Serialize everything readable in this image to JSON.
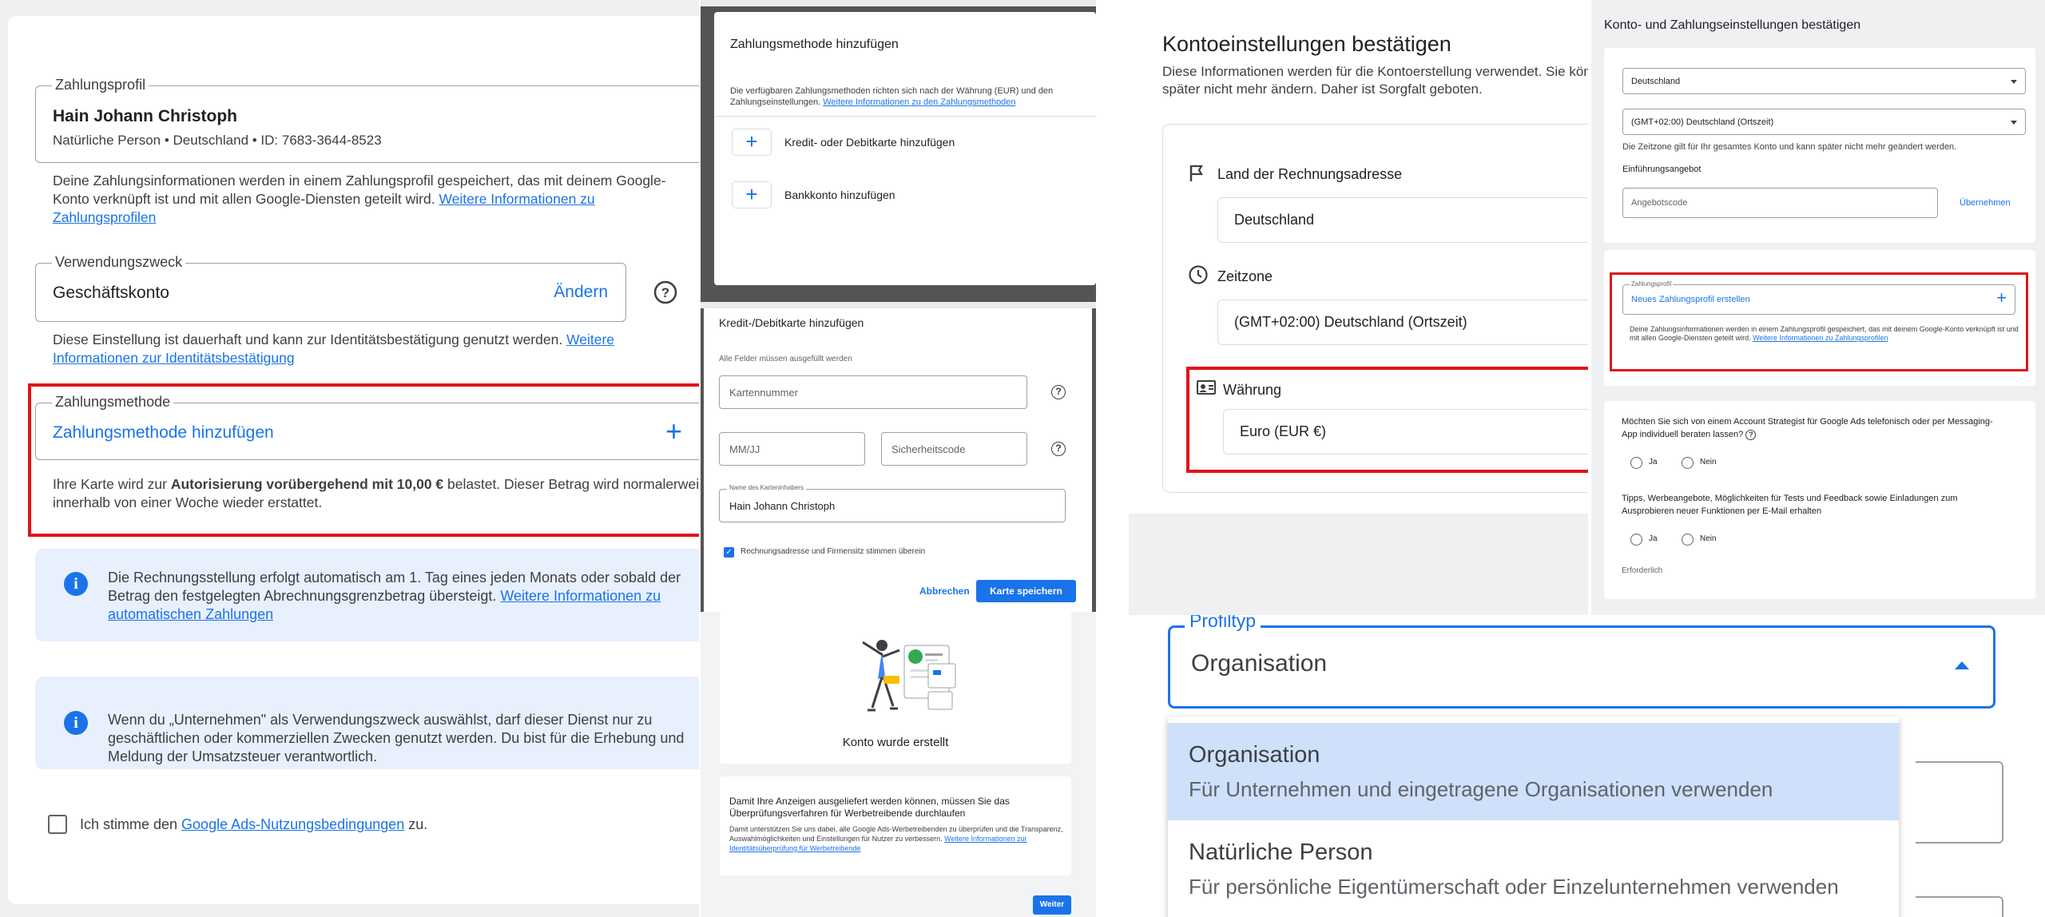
{
  "panel1": {
    "profile": {
      "legend": "Zahlungsprofil",
      "name": "Hain Johann Christoph",
      "details": "Natürliche Person • Deutschland • ID: 7683-3644-8523"
    },
    "profile_info_text": "Deine Zahlungsinformationen werden in einem Zahlungsprofil gespeichert, das mit deinem Google-Konto verknüpft ist und mit allen Google-Diensten geteilt wird.",
    "profile_info_link": "Weitere Informationen zu Zahlungsprofilen",
    "purpose": {
      "legend": "Verwendungszweck",
      "value": "Geschäftskonto",
      "change": "Ändern"
    },
    "purpose_info_text": "Diese Einstellung ist dauerhaft und kann zur Identitätsbestätigung genutzt werden.",
    "purpose_info_link": "Weitere Informationen zur Identitätsbestätigung",
    "method": {
      "legend": "Zahlungsmethode",
      "add": "Zahlungsmethode hinzufügen"
    },
    "auth_text_1": "Ihre Karte wird zur ",
    "auth_bold": "Autorisierung vorübergehend mit 10,00 €",
    "auth_text_2": " belastet. Dieser Betrag wird normalerweise innerhalb von einer Woche wieder erstattet.",
    "billing_info_text": "Die Rechnungsstellung erfolgt automatisch am 1. Tag eines jeden Monats oder sobald der Betrag den festgelegten Abrechnungsgrenzbetrag übersteigt.",
    "billing_info_link": "Weitere Informationen zu automatischen Zahlungen",
    "business_info_text": "Wenn du „Unternehmen\" als Verwendungszweck auswählst, darf dieser Dienst nur zu geschäftlichen oder kommerziellen Zwecken genutzt werden. Du bist für die Erhebung und Meldung der Umsatzsteuer verantwortlich.",
    "terms_text_1": "Ich stimme den ",
    "terms_link": "Google Ads-Nutzungsbedingungen",
    "terms_text_2": " zu."
  },
  "panel2": {
    "title": "Zahlungsmethode hinzufügen",
    "desc": "Die verfügbaren Zahlungsmethoden richten sich nach der Währung (EUR) und den Zahlungseinstellungen.",
    "desc_link": "Weitere Informationen zu den Zahlungsmethoden",
    "option_card": "Kredit- oder Debitkarte hinzufügen",
    "option_bank": "Bankkonto hinzufügen",
    "card_title": "Kredit-/Debitkarte hinzufügen",
    "required_note": "Alle Felder müssen ausgefüllt werden",
    "card_number_placeholder": "Kartennummer",
    "expiry_placeholder": "MM/JJ",
    "cvc_placeholder": "Sicherheitscode",
    "holder_label": "Name des Karteninhabers",
    "holder_value": "Hain Johann Christoph",
    "checkbox_label": "Rechnungsadresse und Firmensitz stimmen überein",
    "cancel": "Abbrechen",
    "save": "Karte speichern",
    "created": "Konto wurde erstellt",
    "verify_title": "Damit Ihre Anzeigen ausgeliefert werden können, müssen Sie das Überprüfungsverfahren für Werbetreibende durchlaufen",
    "verify_text": "Damit unterstützen Sie uns dabei, alle Google Ads-Werbetreibenden zu überprüfen und die Transparenz, Auswahlmöglichkeiten und Einstellungen für Nutzer zu verbessern.",
    "verify_link": "Weitere Informationen zur Identitätsüberprüfung für Werbetreibende",
    "next": "Weiter"
  },
  "panel3": {
    "title": "Kontoeinstellungen bestätigen",
    "desc": "Diese Informationen werden für die Kontoerstellung verwendet. Sie können sie später nicht mehr ändern. Daher ist Sorgfalt geboten.",
    "country_label": "Land der Rechnungsadresse",
    "country_value": "Deutschland",
    "tz_label": "Zeitzone",
    "tz_value": "(GMT+02:00) Deutschland (Ortszeit)",
    "currency_label": "Währung",
    "currency_value": "Euro (EUR €)"
  },
  "panel4": {
    "title": "Konto- und Zahlungseinstellungen bestätigen",
    "country": "Deutschland",
    "timezone": "(GMT+02:00) Deutschland (Ortszeit)",
    "tz_note": "Die Zeitzone gilt für Ihr gesamtes Konto und kann später nicht mehr geändert werden.",
    "promo_label": "Einführungsangebot",
    "promo_placeholder": "Angebotscode",
    "apply": "Übernehmen",
    "profile_legend": "Zahlungsprofil",
    "new_profile": "Neues Zahlungsprofil erstellen",
    "profile_note": "Deine Zahlungsinformationen werden in einem Zahlungsprofil gespeichert, das mit deinem Google-Konto verknüpft ist und mit allen Google-Diensten geteilt wird.",
    "profile_note_link": "Weitere Informationen zu Zahlungsprofilen",
    "q1": "Möchten Sie sich von einem Account Strategist für Google Ads telefonisch oder per Messaging-App individuell beraten lassen?",
    "yes": "Ja",
    "no": "Nein",
    "q2": "Tipps, Werbeangebote, Möglichkeiten für Tests und Feedback sowie Einladungen zum Ausprobieren neuer Funktionen per E-Mail erhalten",
    "required": "Erforderlich"
  },
  "panel5": {
    "legend": "Profiltyp",
    "value": "Organisation",
    "options": [
      {
        "title": "Organisation",
        "desc": "Für Unternehmen und eingetragene Organisationen verwenden"
      },
      {
        "title": "Natürliche Person",
        "desc": "Für persönliche Eigentümerschaft oder Einzelunternehmen verwenden"
      }
    ]
  },
  "colors": {
    "accent": "#1a73e8",
    "highlight": "#e0141b",
    "info_bg": "#e8f0fe",
    "selected_option": "#cfe0fb"
  }
}
